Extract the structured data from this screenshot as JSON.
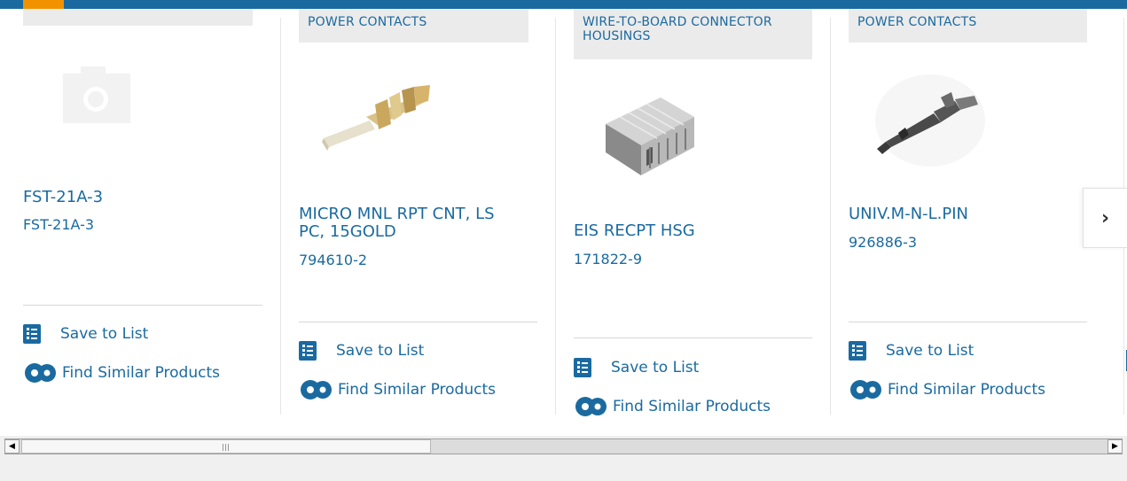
{
  "cards": [
    {
      "category": "",
      "title": "FST-21A-3",
      "part_number": "FST-21A-3",
      "image": "placeholder-camera-icon",
      "save_label": "Save to List",
      "similar_label": "Find Similar Products"
    },
    {
      "category": "POWER CONTACTS",
      "title": "MICRO MNL RPT CNT, LS PC, 15GOLD",
      "part_number": "794610-2",
      "image": "gold-terminal-contact",
      "save_label": "Save to List",
      "similar_label": "Find Similar Products"
    },
    {
      "category": "WIRE-TO-BOARD CONNECTOR HOUSINGS",
      "title": "EIS RECPT HSG",
      "part_number": "171822-9",
      "image": "connector-housing",
      "save_label": "Save to List",
      "similar_label": "Find Similar Products"
    },
    {
      "category": "POWER CONTACTS",
      "title": "UNIV.M-N-L.PIN",
      "part_number": "926886-3",
      "image": "pin-contact",
      "save_label": "Save to List",
      "similar_label": "Find Similar Products"
    }
  ],
  "next_button": {
    "label": "›"
  },
  "colors": {
    "link": "#1a6aa0",
    "category_bg": "#ebebeb",
    "accent": "#f39200"
  }
}
